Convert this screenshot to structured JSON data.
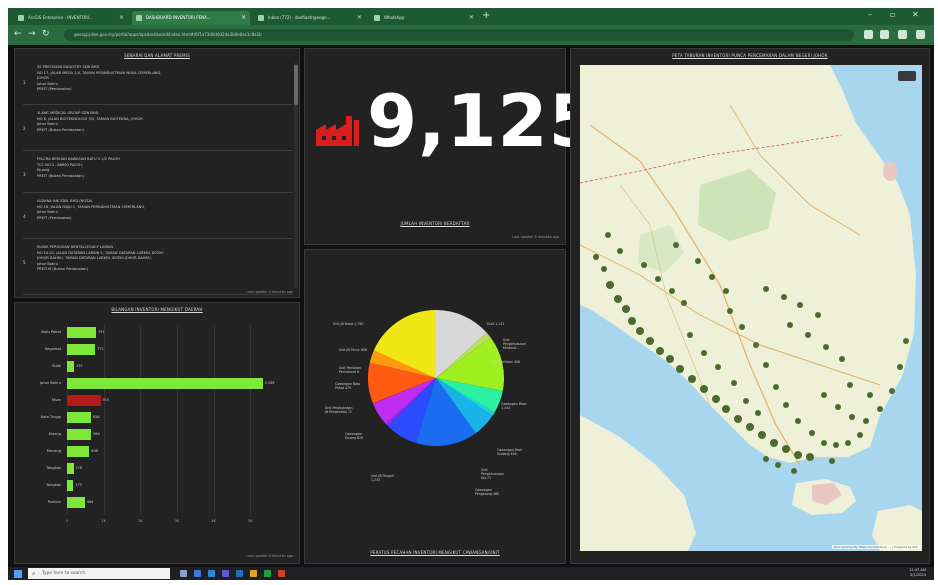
{
  "browser": {
    "tabs": [
      {
        "label": "ArcGIS Enterprise - INVENTORI..."
      },
      {
        "label": "DASHBOARD INVENTORI PENA..."
      },
      {
        "label": "Inbox (772) - doefiastr@eoge..."
      },
      {
        "label": "WhatsApp"
      }
    ],
    "address": "geosppj.doe.gov.my/portal/apps/opsdashboard/index.html#/6f1a73d0d0d24a3b9e0ac1c8a1b"
  },
  "dashboard": {
    "list_title": "SENARAI DAN ALAMAT PREMIS",
    "list_items": [
      {
        "num": "1",
        "lines": [
          "3S PRECISION INDUSTRY SDN BHD",
          "NO 17, JALAN MEGA 1/4, TAMAN PERINDUSTRIAN NUSA CEMERLANG,",
          "JOHOR",
          "Johor Bahru",
          "PREIT (Pembuatan)"
        ]
      },
      {
        "num": "2",
        "lines": [
          "3LANC MEDICAL GROUP SDN BHD",
          "NO 8, JALAN BIOTEKNOLOGI 3/2, TAMAN BIOTEKNA, JOHOR",
          "Johor Bahru",
          "PREIT (Bukan Pembuatan)"
        ]
      },
      {
        "num": "3",
        "lines": [
          "FELCRA BERHAD KAWASAN BATU 3 1/2 PALOH",
          "TCC NO.3 , 86600 PALOH,",
          "Kluang",
          "PREIT (Bukan Pembuatan)"
        ]
      },
      {
        "num": "4",
        "lines": [
          "ALDANA INK SDN. BHD.(NOSA)",
          "NO 18, JALAN MAJU 1, TAMAN PERINDUSTRIAN CEMERLANG,",
          "Johor Bahru",
          "PREIT (Pembuatan)"
        ]
      },
      {
        "num": "5",
        "lines": [
          "KLINIK PERGIGIAN DENTALLEGACY LARKIN",
          "NO 10-01, JALAN DATARAN LARKIN 5, TAMAN DATARAN LARKIN, 80350",
          "JOHOR BAHRU, TAMAN DATARAN LARKIN, 80350 JOHOR BAHRU,",
          "Johor Bahru",
          "PREIT-M (Bukan Pembuatan)"
        ]
      }
    ],
    "list_updated": "Last update: 8 minutes ago",
    "kpi_value": "9,125",
    "kpi_caption": "JUMLAH INVENTORI BERDAFTAR",
    "kpi_updated": "Last update: 8 minutes ago",
    "bar_title": "BILANGAN INVENTORI MENGIKUT DAERAH",
    "bar_updated": "Last update: 8 minutes ago",
    "pie_title": "PERATUS PECAHAN INVENTORI MENGIKUT CAWANGAN/UNIT",
    "pie_labels": [
      {
        "lines": [
          "Unit JB Barat 1,790"
        ]
      },
      {
        "lines": [
          "Kluit 1,123"
        ]
      },
      {
        "lines": [
          "Unit",
          "Pengkhususan",
          "Khidmat ..."
        ]
      },
      {
        "lines": [
          "Unit Penilaian 408"
        ]
      },
      {
        "lines": [
          "Cawangan Muar",
          "1,104"
        ]
      },
      {
        "lines": [
          "Cawangan Pasir",
          "Gudang 456"
        ]
      },
      {
        "lines": [
          "Unit",
          "Pengkhususan",
          "Aia 71"
        ]
      },
      {
        "lines": [
          "Cawangan",
          "Pengerang 480"
        ]
      },
      {
        "lines": [
          "Unit JB Tengah",
          "1,233"
        ]
      },
      {
        "lines": [
          "Cawangan",
          "Kluang 629"
        ]
      },
      {
        "lines": [
          "Unit Pelaksanaan",
          "JB Pengkaltan 71"
        ]
      },
      {
        "lines": [
          "Cawangan Batu",
          "Pahat 479"
        ]
      },
      {
        "lines": [
          "Unit Penilaian",
          "Perindustri 6"
        ]
      },
      {
        "lines": [
          "Unit JB Timur 808"
        ]
      }
    ],
    "map_title": "PETA TABURAN INVENTORI PUNCA PENCEMARAN DALAM NEGERI JOHOR",
    "map_attribution": "Esri Community Maps Contributors, ... | Powered by Esri"
  },
  "chart_data": [
    {
      "type": "bar",
      "orientation": "horizontal",
      "categories": [
        "Batu Pahat",
        "Segamat",
        "Kulai",
        "Johor Bahru",
        "Muar",
        "Kota Tinggi",
        "Kluang",
        "Mersing",
        "Tangkak",
        "Tangkak",
        "Pontian"
      ],
      "values": [
        791,
        771,
        197,
        5336,
        915,
        656,
        664,
        608,
        178,
        175,
        484
      ],
      "value_labels": [
        "791",
        "771",
        "197",
        "5,336",
        "915",
        "656",
        "664",
        "608",
        "178",
        "175",
        "484"
      ],
      "xlim": [
        0,
        6000
      ],
      "x_ticks": [
        "0",
        "1K",
        "2K",
        "3K",
        "4K",
        "5K"
      ],
      "colors": [
        "#7ee83a",
        "#7ee83a",
        "#7ee83a",
        "#7ee83a",
        "#b51a1a",
        "#7ee83a",
        "#7ee83a",
        "#7ee83a",
        "#7ee83a",
        "#7ee83a",
        "#7ee83a"
      ]
    },
    {
      "type": "pie",
      "slices": [
        {
          "name": "Kluit",
          "value": 1123,
          "color": "#d8d8d8"
        },
        {
          "name": "Unit Pengkhususan Khidmat",
          "value": 120,
          "color": "#b8e05a"
        },
        {
          "name": "Cawangan Muar",
          "value": 1104,
          "color": "#a0f020"
        },
        {
          "name": "Cawangan Pasir Gudang",
          "value": 456,
          "color": "#2af0a0"
        },
        {
          "name": "Unit Pengkhususan Aia",
          "value": 71,
          "color": "#18d8e8"
        },
        {
          "name": "Cawangan Pengerang",
          "value": 480,
          "color": "#18b4e8"
        },
        {
          "name": "Unit JB Tengah",
          "value": 1233,
          "color": "#1a6cf0"
        },
        {
          "name": "Cawangan Kluang",
          "value": 629,
          "color": "#2b4bff"
        },
        {
          "name": "Unit Pelaksanaan JB Pengkaltan",
          "value": 71,
          "color": "#7a2bff"
        },
        {
          "name": "Cawangan Batu Pahat",
          "value": 479,
          "color": "#c02bf0"
        },
        {
          "name": "Unit Penilaian Perindustri",
          "value": 6,
          "color": "#f01a1a"
        },
        {
          "name": "Unit JB Timur",
          "value": 808,
          "color": "#ff5a10"
        },
        {
          "name": "Unit JB Barat",
          "value": 1790,
          "color": "#ff9a10"
        }
      ],
      "slice_order_note_colors": [
        "#f0e814"
      ]
    }
  ],
  "taskbar": {
    "search_placeholder": "Type here to search",
    "time": "11:47 AM",
    "date": "3/1/2024"
  }
}
